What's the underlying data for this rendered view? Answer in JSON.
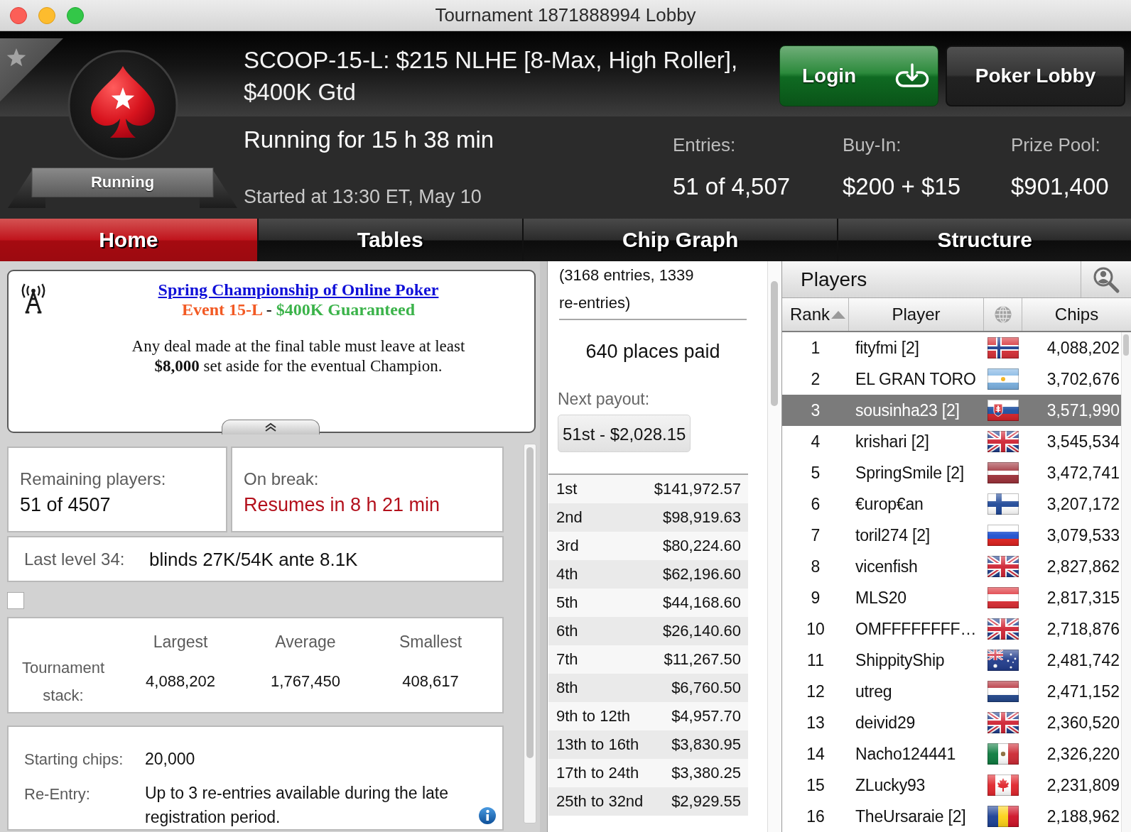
{
  "window": {
    "title": "Tournament 1871888994 Lobby"
  },
  "header": {
    "status": "Running",
    "title": "SCOOP-15-L: $215 NLHE [8-Max, High Roller], $400K Gtd",
    "running_time": "Running for 15 h 38 min",
    "started": "Started at 13:30 ET, May 10",
    "buttons": [
      {
        "label": "Login",
        "kind": "login"
      },
      {
        "label": "Poker Lobby",
        "kind": "lobby"
      }
    ],
    "stats": [
      {
        "label": "Entries:",
        "value": "51 of 4,507"
      },
      {
        "label": "Buy-In:",
        "value": "$200 + $15"
      },
      {
        "label": "Prize Pool:",
        "value": "$901,400"
      }
    ]
  },
  "tabs": [
    {
      "label": "Home",
      "selected": true
    },
    {
      "label": "Tables",
      "selected": false
    },
    {
      "label": "Chip Graph",
      "selected": false
    },
    {
      "label": "Structure",
      "selected": false
    }
  ],
  "announcement": {
    "link": "Spring Championship of Online Poker",
    "event": "Event 15-L",
    "separator": "-",
    "guarantee": "$400K Guaranteed",
    "body": "Any deal made at the final table must leave at least **$8,000** set aside for the eventual Champion."
  },
  "summary": {
    "remaining": {
      "label": "Remaining players:",
      "value": "51 of 4507"
    },
    "break": {
      "label": "On break:",
      "value": "Resumes in 8 h 21 min"
    },
    "level": {
      "label": "Last level 34:",
      "value": "blinds 27K/54K ante 8.1K"
    },
    "checkbox": {
      "checked": false
    },
    "stack": {
      "label": "Tournament stack:",
      "columns": [
        {
          "heading": "Largest",
          "value": "4,088,202"
        },
        {
          "heading": "Average",
          "value": "1,767,450"
        },
        {
          "heading": "Smallest",
          "value": "408,617"
        }
      ]
    },
    "details": [
      {
        "label": "Starting chips:",
        "value": "20,000",
        "info": false
      },
      {
        "label": "Re-Entry:",
        "value": "Up to 3 re-entries available during the late registration period.",
        "info": true
      }
    ]
  },
  "prizes": {
    "entries_note": "(3168 entries, 1339 re-entries)",
    "places_paid": "640 places paid",
    "next_payout_label": "Next payout:",
    "next_payout": "51st - $2,028.15",
    "payouts": [
      {
        "place": "1st",
        "amount": "$141,972.57"
      },
      {
        "place": "2nd",
        "amount": "$98,919.63"
      },
      {
        "place": "3rd",
        "amount": "$80,224.60"
      },
      {
        "place": "4th",
        "amount": "$62,196.60"
      },
      {
        "place": "5th",
        "amount": "$44,168.60"
      },
      {
        "place": "6th",
        "amount": "$26,140.60"
      },
      {
        "place": "7th",
        "amount": "$11,267.50"
      },
      {
        "place": "8th",
        "amount": "$6,760.50"
      },
      {
        "place": "9th to 12th",
        "amount": "$4,957.70"
      },
      {
        "place": "13th to 16th",
        "amount": "$3,830.95"
      },
      {
        "place": "17th to 24th",
        "amount": "$3,380.25"
      },
      {
        "place": "25th to 32nd",
        "amount": "$2,929.55"
      }
    ]
  },
  "players": {
    "title": "Players",
    "columns": [
      {
        "kind": "text",
        "label": "Rank",
        "sorted": true
      },
      {
        "kind": "text",
        "label": "Player",
        "sorted": false
      },
      {
        "kind": "country",
        "sorted": false
      },
      {
        "kind": "text",
        "label": "Chips",
        "sorted": false
      }
    ],
    "rows": [
      {
        "rank": "1",
        "name": "fityfmi [2]",
        "flag": {
          "kind": "norway"
        },
        "chips": "4,088,202",
        "selected": false
      },
      {
        "rank": "2",
        "name": "EL GRAN TORO",
        "flag": {
          "kind": "argentina"
        },
        "chips": "3,702,676",
        "selected": false
      },
      {
        "rank": "3",
        "name": "sousinha23 [2]",
        "flag": {
          "kind": "slovakia"
        },
        "chips": "3,571,990",
        "selected": true
      },
      {
        "rank": "4",
        "name": "krishari [2]",
        "flag": {
          "kind": "uk"
        },
        "chips": "3,545,534",
        "selected": false
      },
      {
        "rank": "5",
        "name": "SpringSmile [2]",
        "flag": {
          "kind": "latvia"
        },
        "chips": "3,472,741",
        "selected": false
      },
      {
        "rank": "6",
        "name": "€urop€an",
        "flag": {
          "kind": "finland"
        },
        "chips": "3,207,172",
        "selected": false
      },
      {
        "rank": "7",
        "name": "toril274 [2]",
        "flag": {
          "kind": "russia"
        },
        "chips": "3,079,533",
        "selected": false
      },
      {
        "rank": "8",
        "name": "vicenfish",
        "flag": {
          "kind": "uk"
        },
        "chips": "2,827,862",
        "selected": false
      },
      {
        "rank": "9",
        "name": "MLS20",
        "flag": {
          "kind": "austria"
        },
        "chips": "2,817,315",
        "selected": false
      },
      {
        "rank": "10",
        "name": "OMFFFFFFFF…",
        "flag": {
          "kind": "uk"
        },
        "chips": "2,718,876",
        "selected": false
      },
      {
        "rank": "11",
        "name": "ShippityShip",
        "flag": {
          "kind": "australia"
        },
        "chips": "2,481,742",
        "selected": false
      },
      {
        "rank": "12",
        "name": "utreg",
        "flag": {
          "kind": "netherlands"
        },
        "chips": "2,471,152",
        "selected": false
      },
      {
        "rank": "13",
        "name": "deivid29",
        "flag": {
          "kind": "uk"
        },
        "chips": "2,360,520",
        "selected": false
      },
      {
        "rank": "14",
        "name": "Nacho124441",
        "flag": {
          "kind": "mexico"
        },
        "chips": "2,326,220",
        "selected": false
      },
      {
        "rank": "15",
        "name": "ZLucky93",
        "flag": {
          "kind": "canada"
        },
        "chips": "2,231,809",
        "selected": false
      },
      {
        "rank": "16",
        "name": "TheUrsaraie [2]",
        "flag": {
          "kind": "romania"
        },
        "chips": "2,188,962",
        "selected": false
      }
    ]
  }
}
